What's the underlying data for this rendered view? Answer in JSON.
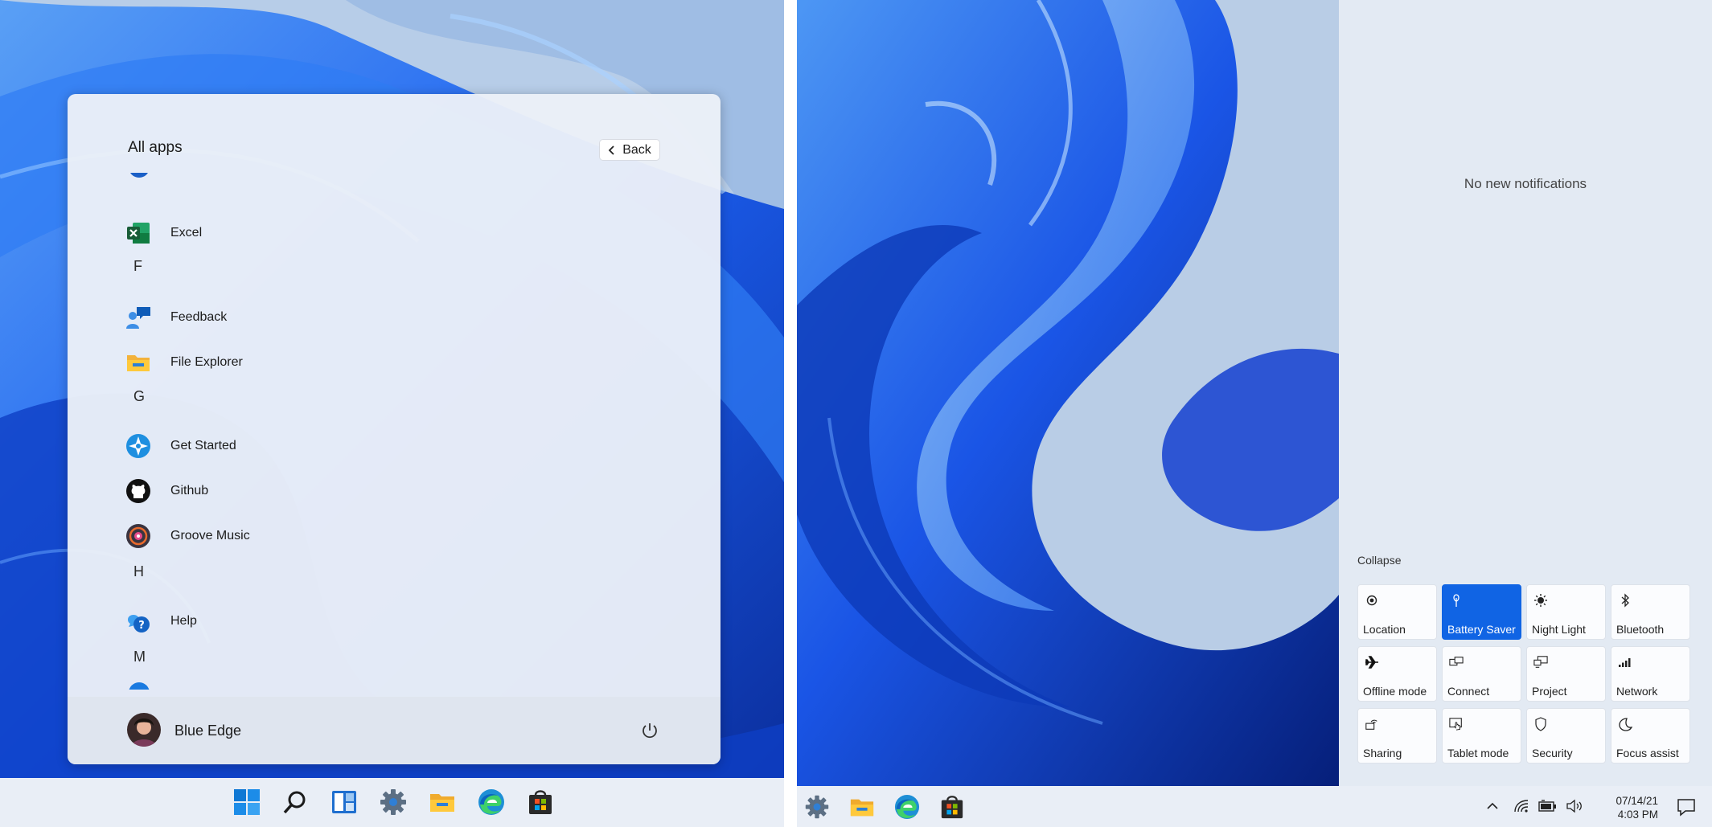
{
  "start_menu": {
    "title": "All apps",
    "back_label": "Back",
    "apps": [
      {
        "type": "app",
        "label": "Excel",
        "icon": "excel-icon"
      },
      {
        "type": "letter",
        "label": "F"
      },
      {
        "type": "app",
        "label": "Feedback",
        "icon": "feedback-icon"
      },
      {
        "type": "app",
        "label": "File Explorer",
        "icon": "file-explorer-icon"
      },
      {
        "type": "letter",
        "label": "G"
      },
      {
        "type": "app",
        "label": "Get Started",
        "icon": "get-started-icon"
      },
      {
        "type": "app",
        "label": "Github",
        "icon": "github-icon"
      },
      {
        "type": "app",
        "label": "Groove Music",
        "icon": "groove-music-icon"
      },
      {
        "type": "letter",
        "label": "H"
      },
      {
        "type": "app",
        "label": "Help",
        "icon": "help-icon"
      },
      {
        "type": "letter",
        "label": "M"
      }
    ],
    "user_name": "Blue Edge"
  },
  "left_taskbar": {
    "icons": [
      "start-icon",
      "search-icon",
      "widgets-icon",
      "settings-icon",
      "file-explorer-icon",
      "edge-icon",
      "store-icon"
    ]
  },
  "notifications": {
    "empty_text": "No new notifications",
    "collapse_label": "Collapse"
  },
  "quick_actions": [
    {
      "label": "Location",
      "icon": "location-icon",
      "active": false
    },
    {
      "label": "Battery Saver",
      "icon": "battery-saver-icon",
      "active": true
    },
    {
      "label": "Night Light",
      "icon": "night-light-icon",
      "active": false
    },
    {
      "label": "Bluetooth",
      "icon": "bluetooth-icon",
      "active": false
    },
    {
      "label": "Offline mode",
      "icon": "airplane-icon",
      "active": false
    },
    {
      "label": "Connect",
      "icon": "connect-icon",
      "active": false
    },
    {
      "label": "Project",
      "icon": "project-icon",
      "active": false
    },
    {
      "label": "Network",
      "icon": "network-icon",
      "active": false
    },
    {
      "label": "Sharing",
      "icon": "sharing-icon",
      "active": false
    },
    {
      "label": "Tablet mode",
      "icon": "tablet-mode-icon",
      "active": false
    },
    {
      "label": "Security",
      "icon": "shield-icon",
      "active": false
    },
    {
      "label": "Focus assist",
      "icon": "moon-icon",
      "active": false
    }
  ],
  "right_taskbar": {
    "icons": [
      "settings-icon",
      "file-explorer-icon",
      "edge-icon",
      "store-icon"
    ],
    "tray": [
      "chevron-up-icon",
      "wifi-icon",
      "battery-icon",
      "volume-icon"
    ],
    "date": "07/14/21",
    "time": "4:03 PM"
  },
  "colors": {
    "accent": "#1064e4",
    "wallpaper_sky": "#b9cde6",
    "wallpaper_blue": "#1a55e6"
  }
}
